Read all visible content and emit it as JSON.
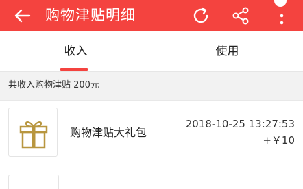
{
  "header": {
    "title": "购物津贴明细",
    "icons": {
      "back": "arrow-left",
      "refresh": "refresh",
      "share": "share",
      "more": "more-vertical"
    },
    "color": "#f4433f"
  },
  "tabs": [
    {
      "label": "收入",
      "selected": true
    },
    {
      "label": "使用",
      "selected": false
    }
  ],
  "summary": {
    "text": "共收入购物津贴 200元"
  },
  "items": [
    {
      "name": "购物津贴大礼包",
      "date": "2018-10-25 13:27:53",
      "amount": "+￥10",
      "icon": "gift-icon",
      "icon_color": "#b8963f"
    }
  ]
}
